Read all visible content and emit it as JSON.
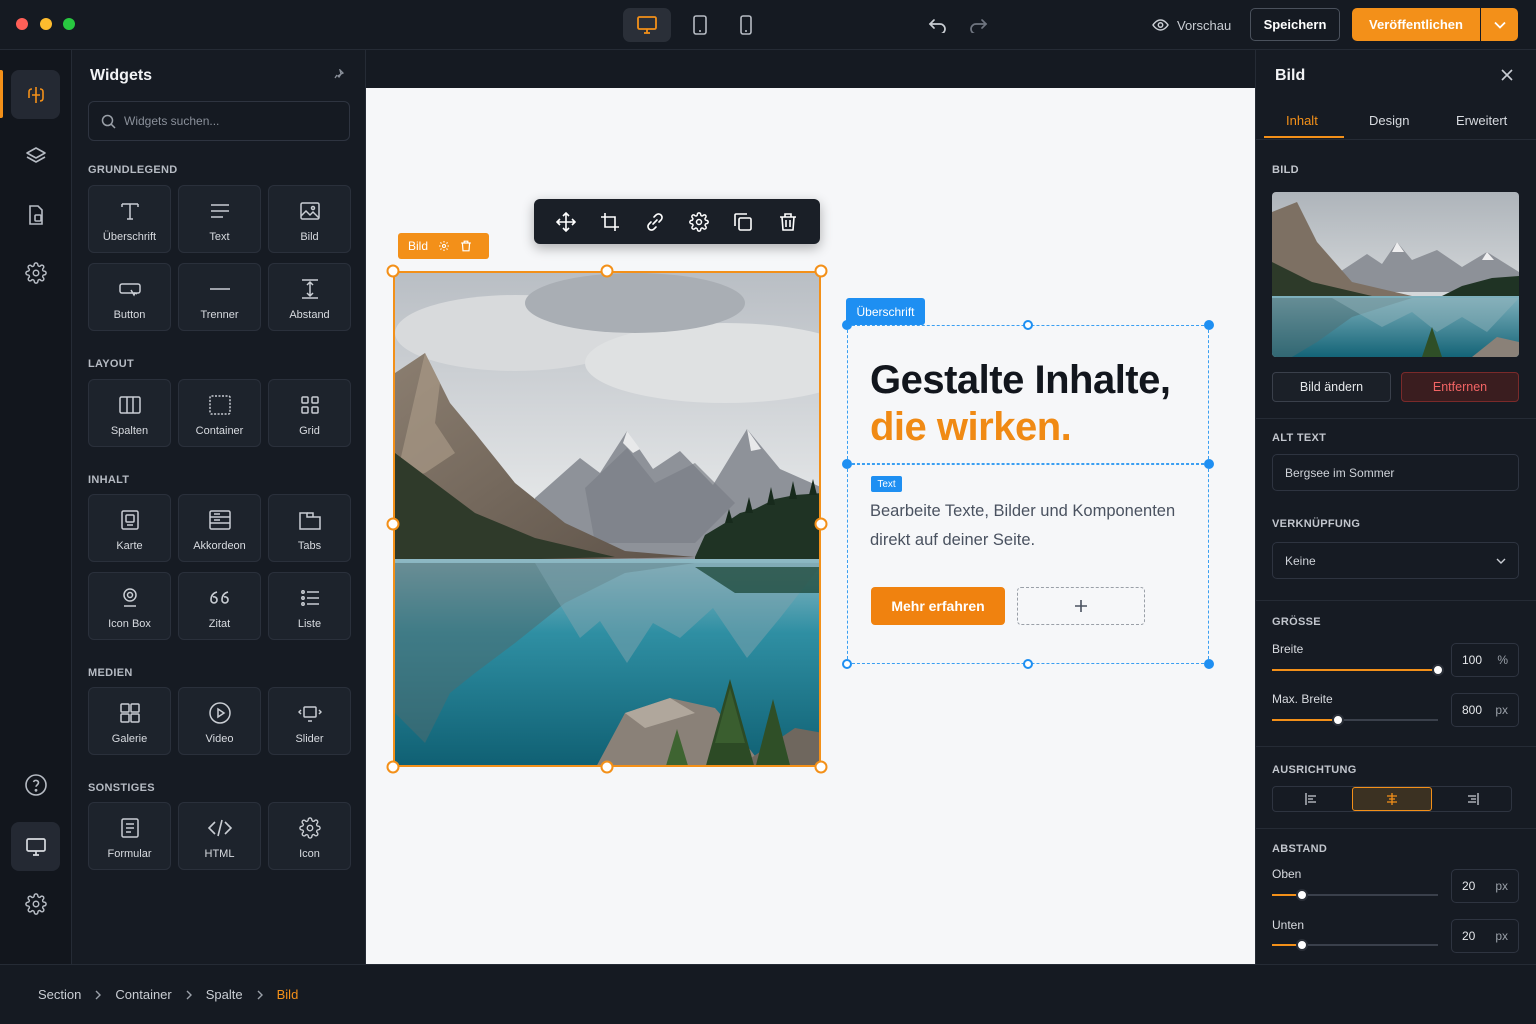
{
  "topbar": {
    "preview_label": "Vorschau",
    "save_label": "Speichern",
    "publish_label": "Veröffentlichen"
  },
  "colors": {
    "accent": "#f39019",
    "selection": "#1e8ff2",
    "panel": "#161b23"
  },
  "widgets": {
    "title": "Widgets",
    "search_placeholder": "Widgets suchen...",
    "categories": [
      {
        "name": "GRUNDLEGEND",
        "items": [
          {
            "label": "Überschrift",
            "icon": "heading-icon"
          },
          {
            "label": "Text",
            "icon": "text-icon"
          },
          {
            "label": "Bild",
            "icon": "image-icon"
          },
          {
            "label": "Button",
            "icon": "button-icon"
          },
          {
            "label": "Trenner",
            "icon": "divider-icon"
          },
          {
            "label": "Abstand",
            "icon": "spacer-icon"
          }
        ]
      },
      {
        "name": "LAYOUT",
        "items": [
          {
            "label": "Spalten",
            "icon": "columns-icon"
          },
          {
            "label": "Container",
            "icon": "container-icon"
          },
          {
            "label": "Grid",
            "icon": "grid-icon"
          }
        ]
      },
      {
        "name": "INHALT",
        "items": [
          {
            "label": "Karte",
            "icon": "card-icon"
          },
          {
            "label": "Akkordeon",
            "icon": "accordion-icon"
          },
          {
            "label": "Tabs",
            "icon": "tabs-icon"
          },
          {
            "label": "Icon Box",
            "icon": "icon-box-icon"
          },
          {
            "label": "Zitat",
            "icon": "quote-icon"
          },
          {
            "label": "Liste",
            "icon": "list-icon"
          }
        ]
      },
      {
        "name": "MEDIEN",
        "items": [
          {
            "label": "Galerie",
            "icon": "gallery-icon"
          },
          {
            "label": "Video",
            "icon": "video-icon"
          },
          {
            "label": "Slider",
            "icon": "slider-icon"
          }
        ]
      },
      {
        "name": "SONSTIGES",
        "items": [
          {
            "label": "Formular",
            "icon": "form-icon"
          },
          {
            "label": "HTML",
            "icon": "html-icon"
          },
          {
            "label": "Icon",
            "icon": "gear-icon"
          }
        ]
      }
    ]
  },
  "canvas": {
    "image_tag": "Bild",
    "heading_tag": "Überschrift",
    "heading_line1": "Gestalte Inhalte,",
    "heading_line2": "die wirken.",
    "text_tag": "Text",
    "body_text": "Bearbeite Texte, Bilder und Komponenten direkt auf deiner Seite.",
    "cta_label": "Mehr erfahren",
    "add_label": "+"
  },
  "inspector": {
    "title": "Bild",
    "tabs": [
      "Inhalt",
      "Design",
      "Erweitert"
    ],
    "active_tab": "Inhalt",
    "image_section": "BILD",
    "change_image": "Bild ändern",
    "remove": "Entfernen",
    "alt_section": "ALT TEXT",
    "alt_value": "Bergsee im Sommer",
    "link_section": "VERKNÜPFUNG",
    "link_value": "Keine",
    "size_section": "GRÖSSE",
    "width_label": "Breite",
    "width_value": "100",
    "width_unit": "%",
    "width_fraction": 1.0,
    "maxwidth_label": "Max. Breite",
    "maxwidth_value": "800",
    "maxwidth_unit": "px",
    "maxwidth_fraction": 0.4,
    "align_section": "AUSRICHTUNG",
    "align_active": "center",
    "spacing_section": "ABSTAND",
    "top_label": "Oben",
    "top_value": "20",
    "top_unit": "px",
    "top_fraction": 0.18,
    "bottom_label": "Unten",
    "bottom_value": "20",
    "bottom_unit": "px",
    "bottom_fraction": 0.18
  },
  "breadcrumb": [
    "Section",
    "Container",
    "Spalte",
    "Bild"
  ]
}
